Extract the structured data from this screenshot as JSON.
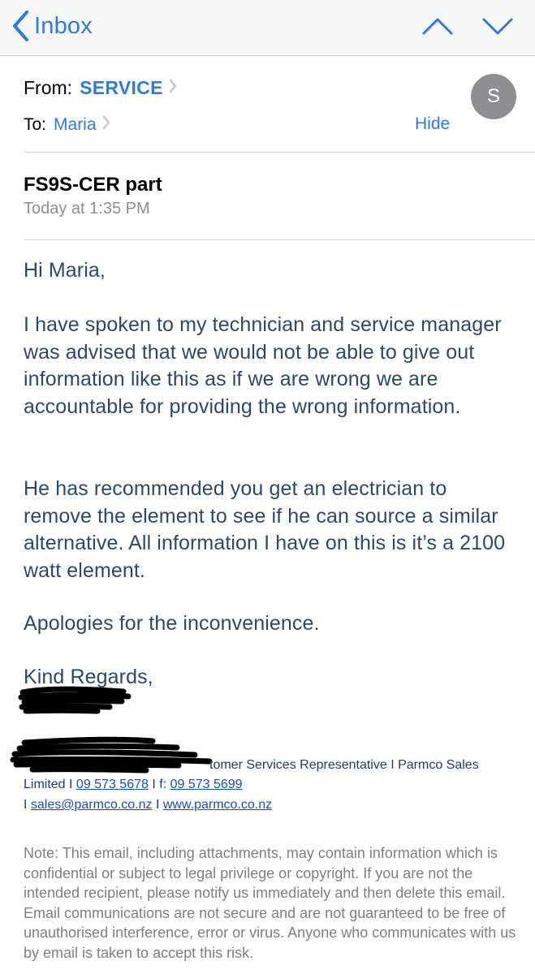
{
  "nav": {
    "back_label": "Inbox"
  },
  "header": {
    "from_label": "From:",
    "from_name": "SERVICE",
    "to_label": "To:",
    "to_name": "Maria",
    "hide_label": "Hide",
    "avatar_initial": "S"
  },
  "message": {
    "subject": "FS9S-CER part",
    "datetime": "Today at 1:35 PM",
    "greeting": "Hi Maria,",
    "paragraph1": "I have spoken to my technician and service manager was advised that we would not be able to give out information like this as if we are wrong we are accountable for providing the wrong information.",
    "paragraph2": "He has recommended you get an electrician to remove the element to see if he can source a similar alternative. All information I have on this is it’s a 2100 watt element.",
    "paragraph3": "Apologies for the inconvenience.",
    "closing": "Kind Regards,"
  },
  "signature": {
    "title_line": "tomer Services Representative I Parmco Sales",
    "limited": "Limited I ",
    "phone": "09 573 5678",
    "fax_prefix": " I f: ",
    "fax": "09 573 5699",
    "line3_prefix": "I ",
    "email": "sales@parmco.co.nz",
    "sep": " I ",
    "website": "www.parmco.co.nz"
  },
  "note": "Note: This email, including attachments, may contain information which is confidential or subject to legal privilege or copyright. If you are not the intended recipient, please notify us immediately and then delete this email. Email communications are not secure and are not guaranteed to be free of unauthorised interference, error or virus. Anyone who communicates with us by email is taken to accept this risk.",
  "colors": {
    "accent": "#2f7ae5",
    "body_text": "#2b4a6b",
    "muted": "#8e8e93"
  }
}
